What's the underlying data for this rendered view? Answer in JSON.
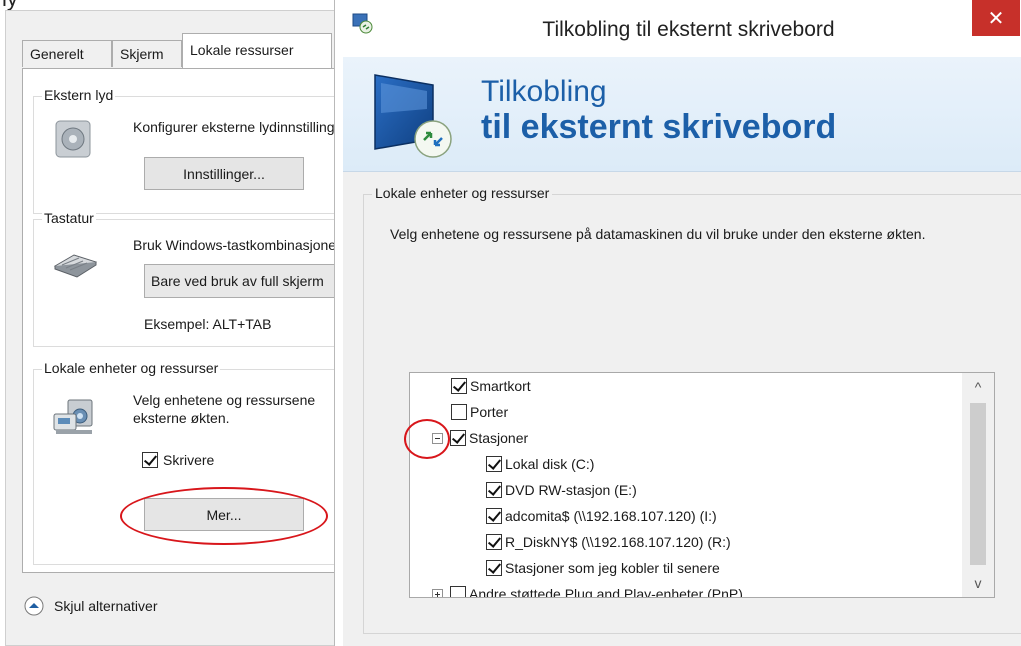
{
  "background_dialog": {
    "title_fragment": "ly",
    "tabs": [
      {
        "label": "Generelt",
        "active": false
      },
      {
        "label": "Skjerm",
        "active": false
      },
      {
        "label": "Lokale ressurser",
        "active": true
      }
    ],
    "groups": {
      "audio": {
        "title": "Ekstern lyd",
        "text": "Konfigurer eksterne lydinnstillinger.",
        "button": "Innstillinger..."
      },
      "keyboard": {
        "title": "Tastatur",
        "text": "Bruk Windows-tastkombinasjoner:",
        "combo_value": "Bare ved bruk av full skjerm",
        "example": "Eksempel: ALT+TAB"
      },
      "local_devices": {
        "title": "Lokale enheter og ressurser",
        "text_line1": "Velg enhetene og ressursene",
        "text_line2": "eksterne økten.",
        "printers_label": "Skrivere",
        "printers_checked": true,
        "more_button": "Mer..."
      }
    },
    "hide_options": "Skjul alternativer"
  },
  "dialog": {
    "title": "Tilkobling til eksternt skrivebord",
    "close_symbol": "✕",
    "banner": {
      "line1": "Tilkobling",
      "line2": "til eksternt skrivebord"
    },
    "group_title": "Lokale enheter og ressurser",
    "description": "Velg enhetene og ressursene på datamaskinen du vil bruke under den eksterne økten.",
    "tree": [
      {
        "label": "Smartkort",
        "checked": true,
        "level": 0,
        "expander": null
      },
      {
        "label": "Porter",
        "checked": false,
        "level": 0,
        "expander": null
      },
      {
        "label": "Stasjoner",
        "checked": true,
        "level": 0,
        "expander": "minus"
      },
      {
        "label": "Lokal disk (C:)",
        "checked": true,
        "level": 1,
        "expander": null
      },
      {
        "label": "DVD RW-stasjon (E:)",
        "checked": true,
        "level": 1,
        "expander": null
      },
      {
        "label": "adcomita$ (\\\\192.168.107.120) (I:)",
        "checked": true,
        "level": 1,
        "expander": null
      },
      {
        "label": "R_DiskNY$ (\\\\192.168.107.120) (R:)",
        "checked": true,
        "level": 1,
        "expander": null
      },
      {
        "label": "Stasjoner som jeg kobler til senere",
        "checked": true,
        "level": 1,
        "expander": null
      },
      {
        "label": "Andre støttede Plug and Play-enheter (PnP)",
        "checked": false,
        "level": 0,
        "expander": "plus"
      }
    ],
    "scroll_up": "^",
    "scroll_down": "v"
  },
  "colors": {
    "accent_blue": "#1c5fa8",
    "close_red": "#c7302a",
    "annotation_red": "#d8161b"
  }
}
